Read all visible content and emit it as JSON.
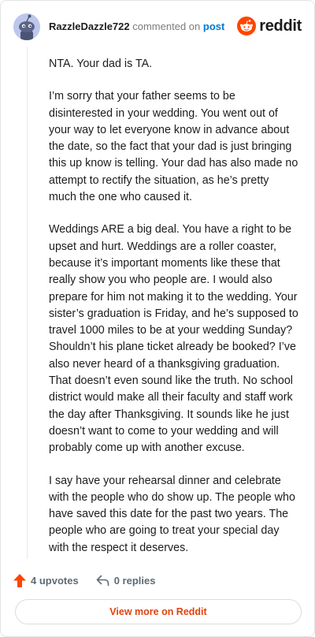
{
  "header": {
    "username": "RazzleDazzle722",
    "commented_text": "commented on",
    "post_link": "post",
    "logo_text": "reddit"
  },
  "comment": {
    "paragraphs": [
      "NTA. Your dad is TA.",
      "I’m sorry that your father seems to be disinterested in your wedding. You went out of your way to let everyone know in advance about the date, so the fact that your dad is just bringing this up know is telling. Your dad has also made no attempt to rectify the situation, as he’s pretty much the one who caused it.",
      "Weddings ARE a big deal. You have a right to be upset and hurt. Weddings are a roller coaster, because it’s important moments like these that really show you who people are. I would also prepare for him not making it to the wedding. Your sister’s graduation is Friday, and he’s supposed to travel 1000 miles to be at your wedding Sunday? Shouldn’t his plane ticket already be booked? I’ve also never heard of a thanksgiving graduation. That doesn’t even sound like the truth. No school district would make all their faculty and staff work the day after Thanksgiving. It sounds like he just doesn’t want to come to your wedding and will probably come up with another excuse.",
      "I say have your rehearsal dinner and celebrate with the people who do show up. The people who have saved this date for the past two years. The people who are going to treat your special day with the respect it deserves."
    ]
  },
  "actions": {
    "upvotes": "4 upvotes",
    "replies": "0 replies"
  },
  "footer": {
    "view_more": "View more on Reddit"
  },
  "colors": {
    "accent": "#ff4500",
    "link": "#0079d3",
    "view_more": "#e0420d"
  },
  "icons": [
    "snoo-avatar-icon",
    "reddit-logo-icon",
    "upvote-arrow-icon",
    "reply-arrow-icon"
  ]
}
